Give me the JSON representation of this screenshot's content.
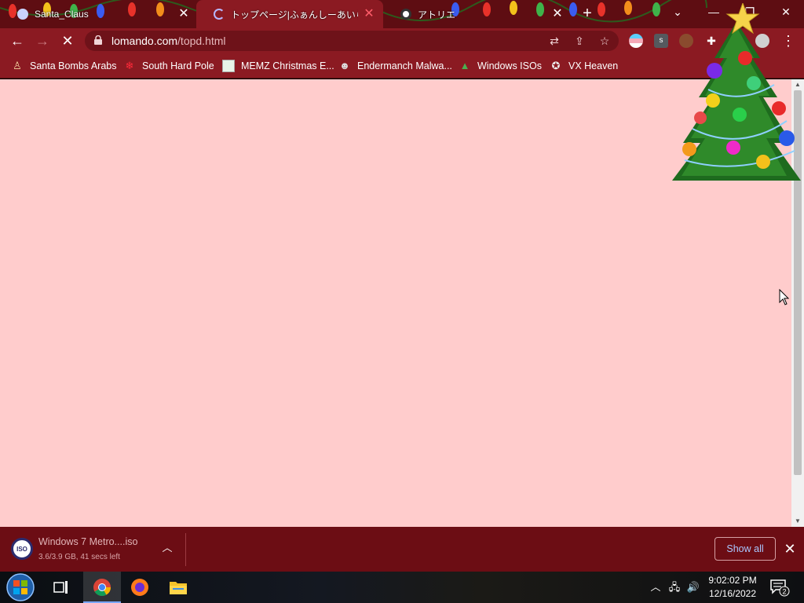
{
  "browser": {
    "tabs": [
      {
        "title": "Santa_Claus",
        "favicon": "santa-favicon",
        "active": false
      },
      {
        "title": "トップページ|ふぁんしーあいらんど",
        "favicon": "loading-favicon",
        "active": true
      },
      {
        "title": "アトリエ",
        "favicon": "panda-favicon",
        "active": false
      }
    ],
    "new_tab_icon": "plus-icon",
    "window_controls": [
      "tab-search-icon",
      "minimize-icon",
      "restore-icon",
      "close-icon"
    ]
  },
  "toolbar": {
    "url_domain": "lomando.com",
    "url_path": "/topd.html",
    "icons": [
      "back-icon",
      "forward-icon",
      "stop-icon",
      "lock-icon",
      "translate-icon",
      "share-icon",
      "star-icon",
      "menu-icon"
    ]
  },
  "bookmarks": [
    {
      "label": "Santa Bombs Arabs",
      "icon": "santa-icon"
    },
    {
      "label": "South Hard Pole",
      "icon": "snowflake-icon"
    },
    {
      "label": "MEMZ Christmas E...",
      "icon": "memz-icon"
    },
    {
      "label": "Endermanch Malwa...",
      "icon": "raccoon-icon"
    },
    {
      "label": "Windows ISOs",
      "icon": "tree-icon"
    },
    {
      "label": "VX Heaven",
      "icon": "vx-icon"
    }
  ],
  "download": {
    "icon_text": "ISO",
    "filename": "Windows 7 Metro....iso",
    "status": "3.6/3.9 GB, 41 secs left",
    "show_all": "Show all"
  },
  "taskbar": {
    "time": "9:02:02 PM",
    "date": "12/16/2022",
    "notification_count": "2"
  },
  "colors": {
    "tab_strip": "#5e0d12",
    "toolbar": "#8b1a22",
    "page_background": "#ffcccc",
    "shelf": "#6c0d14"
  }
}
